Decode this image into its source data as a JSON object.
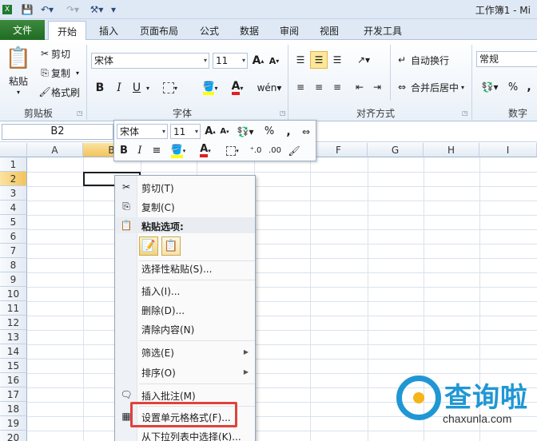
{
  "title": "工作簿1 - Mi",
  "tabs": [
    "文件",
    "开始",
    "插入",
    "页面布局",
    "公式",
    "数据",
    "审阅",
    "视图",
    "开发工具"
  ],
  "clipboard": {
    "paste": "粘贴",
    "cut": "剪切",
    "copy": "复制",
    "format_painter": "格式刷",
    "label": "剪贴板"
  },
  "font": {
    "name": "宋体",
    "size": "11",
    "label": "字体",
    "bold": "B",
    "italic": "I",
    "underline": "U"
  },
  "alignment": {
    "wrap": "自动换行",
    "merge": "合并后居中",
    "label": "对齐方式"
  },
  "number": {
    "format": "常规",
    "label": "数字",
    "percent": "%",
    "comma": ","
  },
  "namebox": "B2",
  "columns": [
    "A",
    "B",
    "C",
    "D",
    "E",
    "F",
    "G",
    "H",
    "I"
  ],
  "rows": [
    "1",
    "2",
    "3",
    "4",
    "5",
    "6",
    "7",
    "8",
    "9",
    "10",
    "11",
    "12",
    "13",
    "14",
    "15",
    "16",
    "17",
    "18",
    "19",
    "20"
  ],
  "minibar": {
    "font": "宋体",
    "size": "11",
    "bold": "B",
    "italic": "I",
    "percent": "%",
    "comma": ","
  },
  "menu": {
    "cut": "剪切(T)",
    "copy": "复制(C)",
    "paste_options": "粘贴选项:",
    "paste_special": "选择性粘贴(S)...",
    "insert": "插入(I)...",
    "delete": "删除(D)...",
    "clear": "清除内容(N)",
    "filter": "筛选(E)",
    "sort": "排序(O)",
    "comment": "插入批注(M)",
    "format_cells": "设置单元格格式(F)...",
    "pick_list": "从下拉列表中选择(K)..."
  },
  "watermark": {
    "text": "查询啦",
    "url": "chaxunla.com"
  },
  "colors": {
    "file_tab": "#2a7d2e",
    "highlight": "#e0423c",
    "watermark": "#1f97d4"
  }
}
